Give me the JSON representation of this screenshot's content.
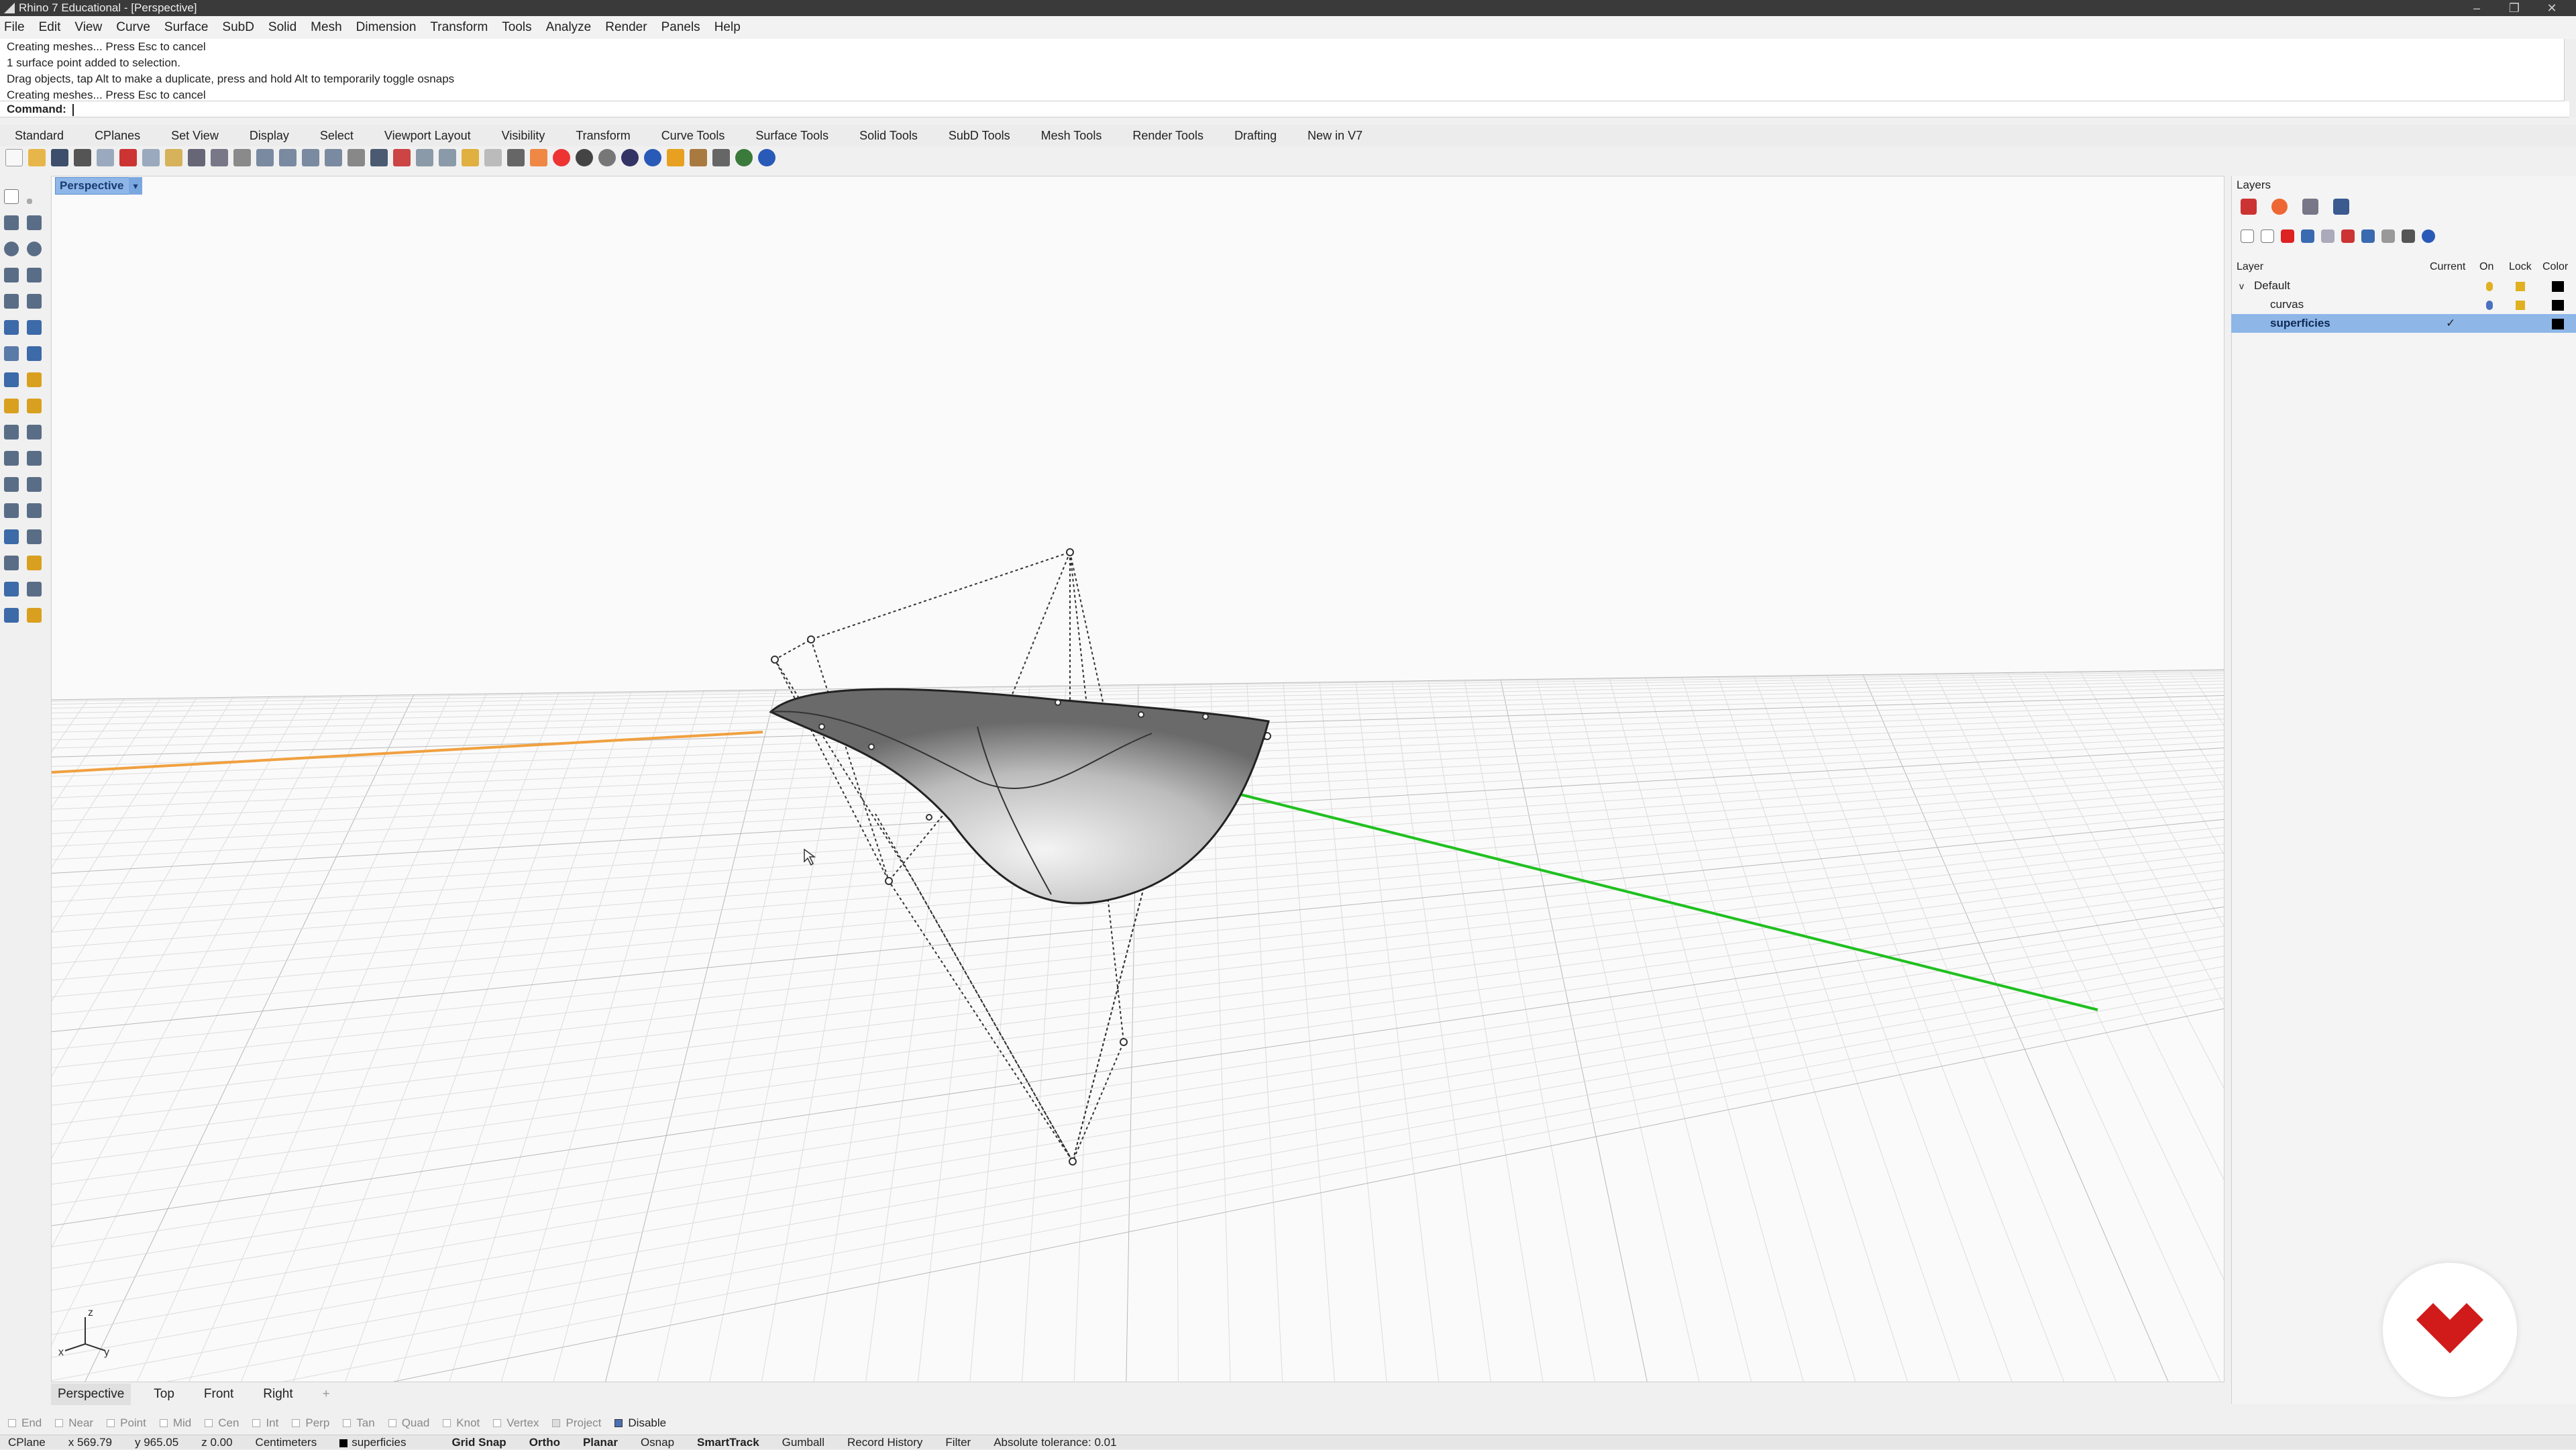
{
  "window": {
    "title": "Rhino 7 Educational - [Perspective]"
  },
  "menu": [
    "File",
    "Edit",
    "View",
    "Curve",
    "Surface",
    "SubD",
    "Solid",
    "Mesh",
    "Dimension",
    "Transform",
    "Tools",
    "Analyze",
    "Render",
    "Panels",
    "Help"
  ],
  "history": [
    "Creating meshes... Press Esc to cancel",
    "1 surface point added to selection.",
    "Drag objects, tap Alt to make a duplicate, press and hold Alt to temporarily toggle osnaps",
    "Creating meshes... Press Esc to cancel"
  ],
  "command": {
    "label": "Command:"
  },
  "toolbar_tabs": [
    "Standard",
    "CPlanes",
    "Set View",
    "Display",
    "Select",
    "Viewport Layout",
    "Visibility",
    "Transform",
    "Curve Tools",
    "Surface Tools",
    "Solid Tools",
    "SubD Tools",
    "Mesh Tools",
    "Render Tools",
    "Drafting",
    "New in V7"
  ],
  "viewport": {
    "active_tab": "Perspective",
    "tab_arrow": "▾"
  },
  "viewport_tabs": [
    "Perspective",
    "Top",
    "Front",
    "Right",
    "+"
  ],
  "axis": {
    "z": "z",
    "x": "x",
    "y": "y"
  },
  "layers_panel": {
    "title": "Layers",
    "header": {
      "layer": "Layer",
      "current": "Current",
      "on": "On",
      "lock": "Lock",
      "color": "Color"
    },
    "rows": [
      {
        "name": "Default",
        "current": "",
        "expanded": "v"
      },
      {
        "name": "curvas",
        "current": ""
      },
      {
        "name": "superficies",
        "current": "✓"
      }
    ]
  },
  "osnaps": [
    "End",
    "Near",
    "Point",
    "Mid",
    "Cen",
    "Int",
    "Perp",
    "Tan",
    "Quad",
    "Knot",
    "Vertex",
    "Project"
  ],
  "osnap_disable": "Disable",
  "status": {
    "cplane": "CPlane",
    "x": "x 569.79",
    "y": "y 965.05",
    "z": "z 0.00",
    "units": "Centimeters",
    "layer": "superficies",
    "grid_snap": "Grid Snap",
    "ortho": "Ortho",
    "planar": "Planar",
    "osnap": "Osnap",
    "smarttrack": "SmartTrack",
    "gumball": "Gumball",
    "record_history": "Record History",
    "filter": "Filter",
    "tolerance": "Absolute tolerance: 0.01"
  },
  "colors": {
    "accent": "#8eb7e8",
    "x_axis": "#f0a040",
    "y_axis": "#20c020",
    "logo_red": "#d11a1a"
  }
}
